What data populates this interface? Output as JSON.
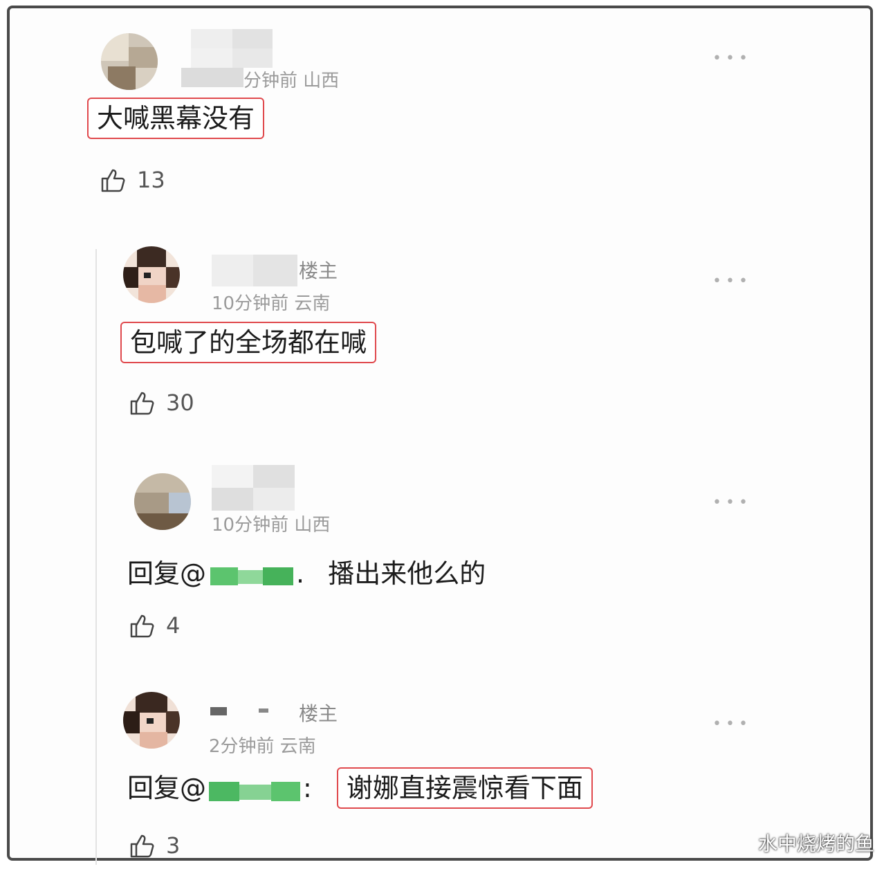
{
  "comments": [
    {
      "meta": "分钟前 山西",
      "text": "大喊黑幕没有",
      "likes": "13",
      "owner": ""
    },
    {
      "owner": "楼主",
      "meta": "10分钟前 云南",
      "text": "包喊了的全场都在喊",
      "likes": "30"
    },
    {
      "meta": "10分钟前 山西",
      "reply_prefix": "回复@",
      "reply_suffix": ".",
      "text": "播出来他么的",
      "likes": "4"
    },
    {
      "owner": "楼主",
      "meta": "2分钟前 云南",
      "reply_prefix": "回复@",
      "reply_suffix": ":",
      "text": "谢娜直接震惊看下面",
      "likes": "3"
    }
  ],
  "more_label": "•••",
  "watermark": "水中烧烤的鱼",
  "colors": {
    "highlight_border": "#e0494d",
    "frame": "#4a4a4a"
  },
  "icons": {
    "like": "thumbs-up-icon",
    "more": "more-dots-icon"
  }
}
